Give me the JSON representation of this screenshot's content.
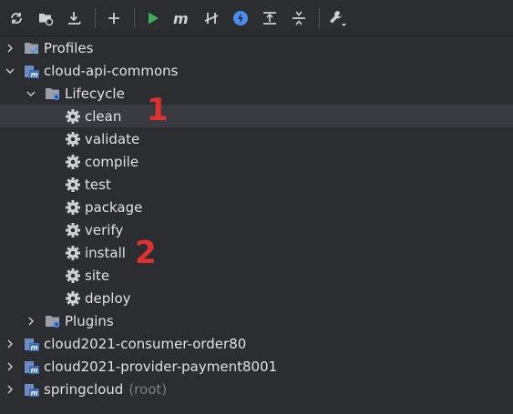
{
  "toolbar": {
    "buttons": [
      {
        "name": "reload-icon"
      },
      {
        "name": "add-project-icon"
      },
      {
        "name": "download-icon"
      },
      {
        "name": "plus-icon"
      },
      {
        "name": "run-icon"
      },
      {
        "name": "maven-goal-icon"
      },
      {
        "name": "toggle-offline-icon"
      },
      {
        "name": "skip-tests-icon"
      },
      {
        "name": "show-dependencies-icon"
      },
      {
        "name": "collapse-all-icon"
      },
      {
        "name": "settings-wrench-icon"
      }
    ],
    "colors": {
      "run": "#3fae5a",
      "lightning": "#4a8cf0"
    }
  },
  "tree": {
    "profiles": "Profiles",
    "module1": "cloud-api-commons",
    "lifecycle": "Lifecycle",
    "goals": [
      "clean",
      "validate",
      "compile",
      "test",
      "package",
      "verify",
      "install",
      "site",
      "deploy"
    ],
    "plugins": "Plugins",
    "module2": "cloud2021-consumer-order80",
    "module3": "cloud2021-provider-payment8001",
    "module4": "springcloud",
    "module4_suffix": "(root)"
  },
  "annotations": {
    "first": "1",
    "second": "2",
    "color": "#e03131"
  }
}
